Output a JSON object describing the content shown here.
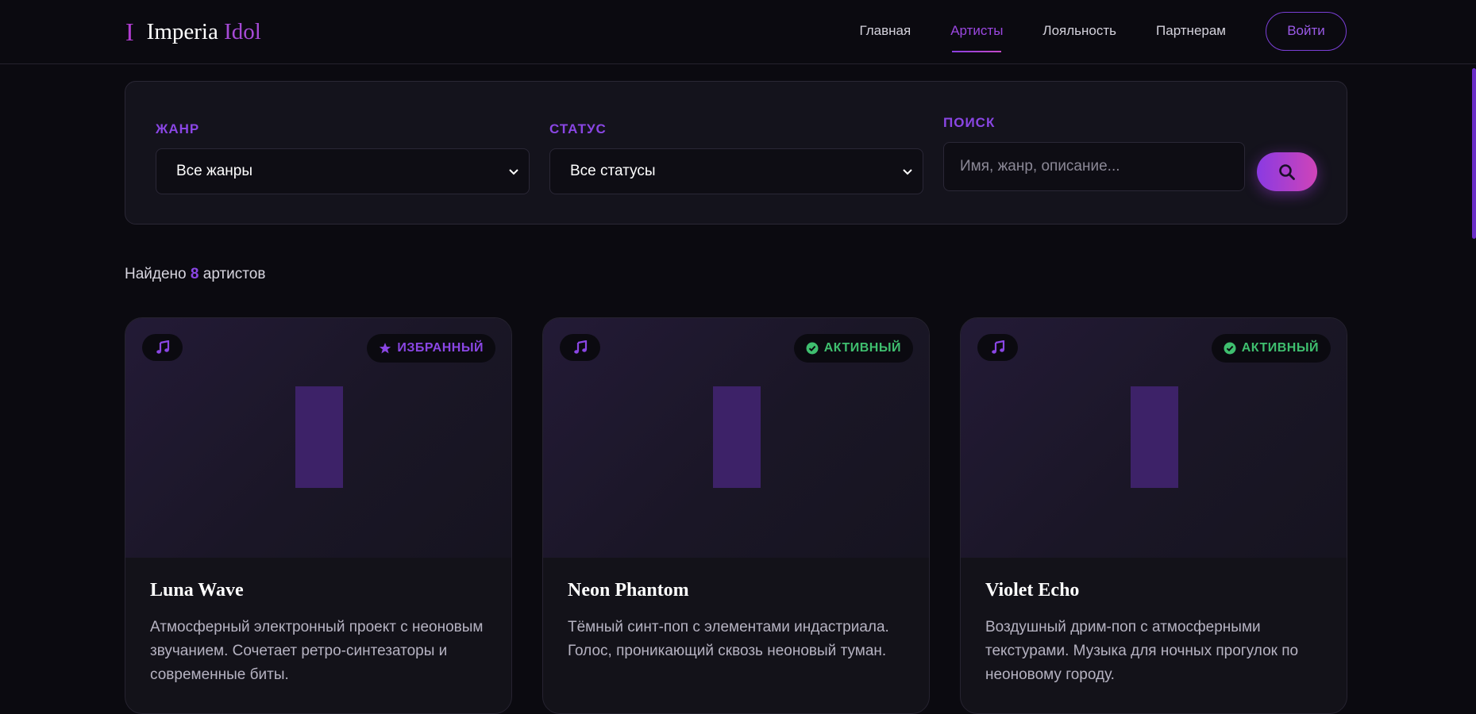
{
  "header": {
    "logo_mark": "I",
    "logo_part1": "Imperia",
    "logo_part2": "Idol",
    "nav": [
      "Главная",
      "Артисты",
      "Лояльность",
      "Партнерам"
    ],
    "active_nav": "Артисты",
    "login_label": "Войти"
  },
  "filters": {
    "genre_label": "ЖАНР",
    "genre_value": "Все жанры",
    "status_label": "СТАТУС",
    "status_value": "Все статусы",
    "search_label": "ПОИСК",
    "search_placeholder": "Имя, жанр, описание..."
  },
  "results": {
    "prefix": "Найдено",
    "count": "8",
    "suffix": "артистов"
  },
  "cards": [
    {
      "title": "Luna Wave",
      "badge": "ИЗБРАННЫЙ",
      "badge_kind": "featured",
      "description": "Атмосферный электронный проект с неоновым звучанием. Сочетает ретро-синтезаторы и современные биты."
    },
    {
      "title": "Neon Phantom",
      "badge": "АКТИВНЫЙ",
      "badge_kind": "active",
      "description": "Тёмный синт-поп с элементами индастриала. Голос, проникающий сквозь неоновый туман."
    },
    {
      "title": "Violet Echo",
      "badge": "АКТИВНЫЙ",
      "badge_kind": "active",
      "description": "Воздушный дрим-поп с атмосферными текстурами. Музыка для ночных прогулок по неоновому городу."
    }
  ],
  "colors": {
    "accent": "#8a46e4",
    "active_status": "#3fbf6f",
    "background": "#0b0a10"
  }
}
